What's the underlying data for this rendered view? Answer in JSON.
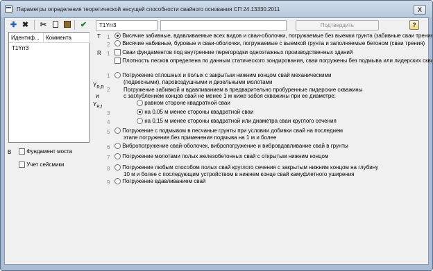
{
  "window": {
    "title": "Параметры определения теоретической несущей способности свайного основания СП 24.13330.2011",
    "close_label": "X"
  },
  "toolbar": {
    "add_icon": "plus-icon",
    "delete_icon": "cross-icon",
    "cut_icon": "scissors-icon",
    "copy_icon": "copy-icon",
    "paste_icon": "paste-icon",
    "apply_icon": "check-icon"
  },
  "list": {
    "columns": [
      "Идентиф...",
      "Коммента"
    ],
    "rows": [
      {
        "id": "T1Yrr3",
        "comment": ""
      }
    ]
  },
  "header": {
    "id_value": "T1Yrr3",
    "comment_value": "",
    "confirm_label": "Подтвердить",
    "help_label": "?"
  },
  "section_T": {
    "letter": "T",
    "options": [
      {
        "num": "1",
        "label": "Висячие забивные, вдавливаемые всех видов и сваи-оболочки, погружаемые без выемки грунта (забивные сваи трения)",
        "selected": true
      },
      {
        "num": "2",
        "label": "Висячие набивные, буровые и сваи-оболочки, погружаемые с выемкой грунта и заполняемые бетоном (сваи трения)",
        "selected": false
      }
    ]
  },
  "section_R": {
    "letter": "R",
    "checks": [
      {
        "num": "1",
        "label": "Сваи фундаментов под внутренние перегородки одноэтажных производственных зданий",
        "checked": false
      },
      {
        "num": "",
        "label": "Плотность песков определена по данным статического зондирования, сваи погружены без подмыва или лидерских скважин",
        "checked": false
      }
    ]
  },
  "section_Y": {
    "labels": [
      "Y",
      "R,R",
      "и",
      "Y",
      "R,f"
    ],
    "options": [
      {
        "num": "1",
        "line1": "Погружение сплошных и полых с закрытым нижним концом свай механическими",
        "line2": "(подвесными), паровоздушными и дизельными молотами",
        "selected": false
      },
      {
        "num": "2",
        "line1": "Погружение забивкой и вдавливанием в предварительно пробуренные лидерские скважины",
        "line2": "с заглублением концов свай не менее 1 м ниже забоя скважины при ее диаметре:",
        "selected": false
      },
      {
        "num": "",
        "label": "равном стороне квадратной сваи",
        "selected": false
      },
      {
        "num": "3",
        "label": "на 0,05 м менее стороны квадратной сваи",
        "selected": true
      },
      {
        "num": "4",
        "label": "на 0,15 м менее стороны квадратной или диаметра сваи круглого сечения",
        "selected": false
      },
      {
        "num": "5",
        "line1": "Погружение с подмывом в песчаные грунты при условии добивки свай на последнем",
        "line2": "этапе погружения без применения подмыва на 1 м и более",
        "selected": false
      },
      {
        "num": "6",
        "label": "Вибропогружение свай-оболочек, вибропогружение и вибровдавливание свай в грунты",
        "selected": false
      },
      {
        "num": "7",
        "label": "Погружение молотами полых железобетонных свай с открытым нижним концом",
        "selected": false
      },
      {
        "num": "8",
        "line1": "Погружение любым способом полых свай круглого сечения с закрытым нижним концом на глубину",
        "line2": "10 м и более с последующим устройством в нижнем конце свай камуфлетного уширения",
        "selected": false
      },
      {
        "num": "9",
        "label": "Погружение вдавливанием свай",
        "selected": false
      }
    ]
  },
  "bottom": {
    "letter_B": "В",
    "bridge_label": "Фундамент моста",
    "bridge_checked": false,
    "seismic_label": "Учет сейсмики",
    "seismic_checked": false
  }
}
